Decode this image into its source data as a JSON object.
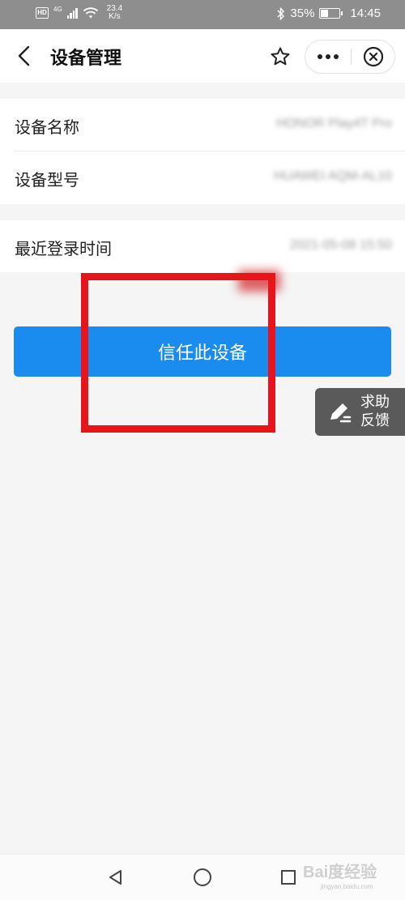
{
  "status_bar": {
    "network": "4G",
    "speed_value": "23.4",
    "speed_unit": "K/s",
    "battery": "35%",
    "time": "14:45"
  },
  "nav": {
    "title": "设备管理"
  },
  "device_info": {
    "rows": [
      {
        "label": "设备名称",
        "value": "HONOR Play4T Pro"
      },
      {
        "label": "设备型号",
        "value": "HUAWEI AQM-AL10"
      }
    ],
    "last_login": {
      "label": "最近登录时间",
      "value": "2021-05-08 15:50"
    }
  },
  "actions": {
    "trust_button_label": "信任此设备"
  },
  "feedback": {
    "label": "求助\n反馈"
  },
  "watermark": {
    "brand": "Bai度经验",
    "url": "jingyan.baidu.com"
  },
  "colors": {
    "primary_button": "#1a8cf0",
    "annotation_red": "#e8141b",
    "feedback_bg": "#5a5a5a",
    "status_bar_bg": "#8e8e8e"
  }
}
